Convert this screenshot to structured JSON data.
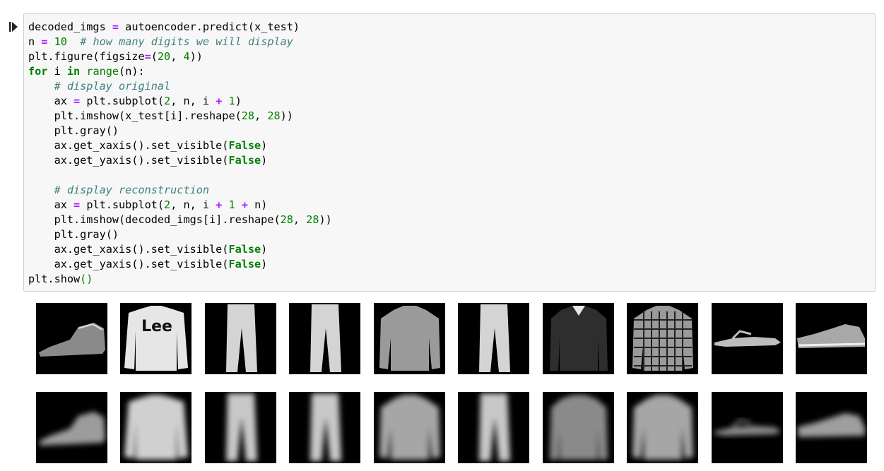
{
  "cell": {
    "run_icon": "run-cell-icon",
    "lines": [
      [
        {
          "t": "decoded_imgs "
        },
        {
          "t": "=",
          "c": "op"
        },
        {
          "t": " autoencoder.predict(x_test)"
        }
      ],
      [
        {
          "t": "n "
        },
        {
          "t": "=",
          "c": "op"
        },
        {
          "t": " "
        },
        {
          "t": "10",
          "c": "num"
        },
        {
          "t": "  "
        },
        {
          "t": "# how many digits we will display",
          "c": "com"
        }
      ],
      [
        {
          "t": "plt.figure(figsize"
        },
        {
          "t": "=",
          "c": "op"
        },
        {
          "t": "("
        },
        {
          "t": "20",
          "c": "num"
        },
        {
          "t": ", "
        },
        {
          "t": "4",
          "c": "num"
        },
        {
          "t": "))"
        }
      ],
      [
        {
          "t": "for",
          "c": "kw"
        },
        {
          "t": " i "
        },
        {
          "t": "in",
          "c": "kw"
        },
        {
          "t": " "
        },
        {
          "t": "range",
          "c": "builtin"
        },
        {
          "t": "(n):"
        }
      ],
      [
        {
          "t": "    "
        },
        {
          "t": "# display original",
          "c": "com"
        }
      ],
      [
        {
          "t": "    ax "
        },
        {
          "t": "=",
          "c": "op"
        },
        {
          "t": " plt.subplot("
        },
        {
          "t": "2",
          "c": "num"
        },
        {
          "t": ", n, i "
        },
        {
          "t": "+",
          "c": "op"
        },
        {
          "t": " "
        },
        {
          "t": "1",
          "c": "num"
        },
        {
          "t": ")"
        }
      ],
      [
        {
          "t": "    plt.imshow(x_test[i].reshape("
        },
        {
          "t": "28",
          "c": "num"
        },
        {
          "t": ", "
        },
        {
          "t": "28",
          "c": "num"
        },
        {
          "t": "))"
        }
      ],
      [
        {
          "t": "    plt.gray()"
        }
      ],
      [
        {
          "t": "    ax.get_xaxis().set_visible("
        },
        {
          "t": "False",
          "c": "kw"
        },
        {
          "t": ")"
        }
      ],
      [
        {
          "t": "    ax.get_yaxis().set_visible("
        },
        {
          "t": "False",
          "c": "kw"
        },
        {
          "t": ")"
        }
      ],
      [
        {
          "t": ""
        }
      ],
      [
        {
          "t": "    "
        },
        {
          "t": "# display reconstruction",
          "c": "com"
        }
      ],
      [
        {
          "t": "    ax "
        },
        {
          "t": "=",
          "c": "op"
        },
        {
          "t": " plt.subplot("
        },
        {
          "t": "2",
          "c": "num"
        },
        {
          "t": ", n, i "
        },
        {
          "t": "+",
          "c": "op"
        },
        {
          "t": " "
        },
        {
          "t": "1",
          "c": "num"
        },
        {
          "t": " "
        },
        {
          "t": "+",
          "c": "op"
        },
        {
          "t": " n)"
        }
      ],
      [
        {
          "t": "    plt.imshow(decoded_imgs[i].reshape("
        },
        {
          "t": "28",
          "c": "num"
        },
        {
          "t": ", "
        },
        {
          "t": "28",
          "c": "num"
        },
        {
          "t": "))"
        }
      ],
      [
        {
          "t": "    plt.gray()"
        }
      ],
      [
        {
          "t": "    ax.get_xaxis().set_visible("
        },
        {
          "t": "False",
          "c": "kw"
        },
        {
          "t": ")"
        }
      ],
      [
        {
          "t": "    ax.get_yaxis().set_visible("
        },
        {
          "t": "False",
          "c": "kw"
        },
        {
          "t": ")"
        }
      ],
      [
        {
          "t": "plt.show"
        },
        {
          "t": "()",
          "c": "paren-hl"
        }
      ]
    ]
  },
  "output": {
    "originals": [
      "ankle-boot",
      "pullover",
      "trouser",
      "trouser",
      "shirt",
      "trouser",
      "coat",
      "shirt",
      "sandal",
      "sneaker"
    ],
    "reconstructions": [
      "ankle-boot",
      "pullover",
      "trouser",
      "trouser",
      "shirt",
      "trouser",
      "coat",
      "shirt",
      "sandal",
      "sneaker"
    ],
    "pullover_logo_text": "Lee"
  }
}
